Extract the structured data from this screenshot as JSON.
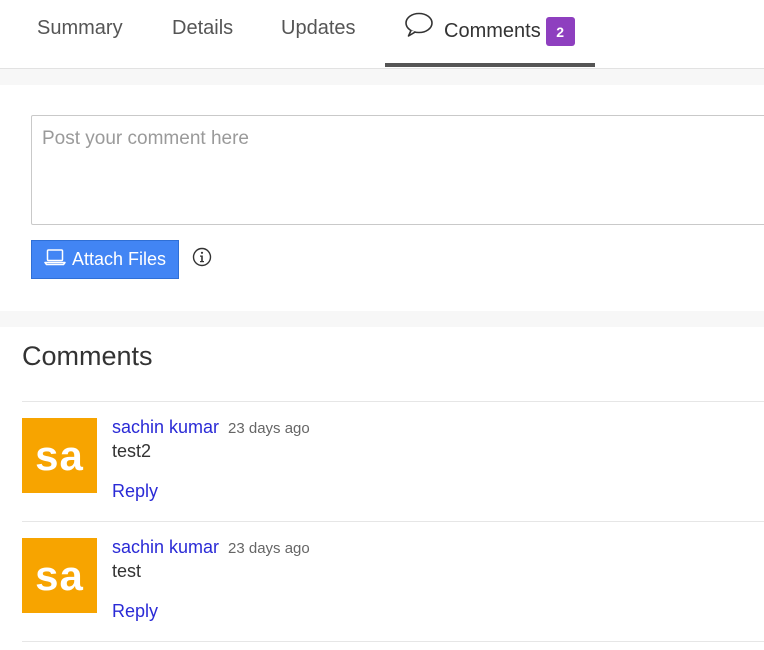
{
  "tabs": {
    "summary": "Summary",
    "details": "Details",
    "updates": "Updates",
    "comments": "Comments",
    "comments_count": "2"
  },
  "composer": {
    "placeholder": "Post your comment here",
    "value": "",
    "attach_label": "Attach Files",
    "attach_icon": "laptop-icon",
    "info_icon": "info-icon"
  },
  "comments_section": {
    "title": "Comments",
    "items": [
      {
        "avatar_initials": "sa",
        "author": "sachin kumar",
        "time": "23 days ago",
        "text": "test2",
        "reply_label": "Reply"
      },
      {
        "avatar_initials": "sa",
        "author": "sachin kumar",
        "time": "23 days ago",
        "text": "test",
        "reply_label": "Reply"
      }
    ]
  },
  "colors": {
    "accent_button": "#4285f4",
    "badge": "#8e3fbf",
    "avatar": "#f7a400",
    "link": "#2a2ad6"
  }
}
